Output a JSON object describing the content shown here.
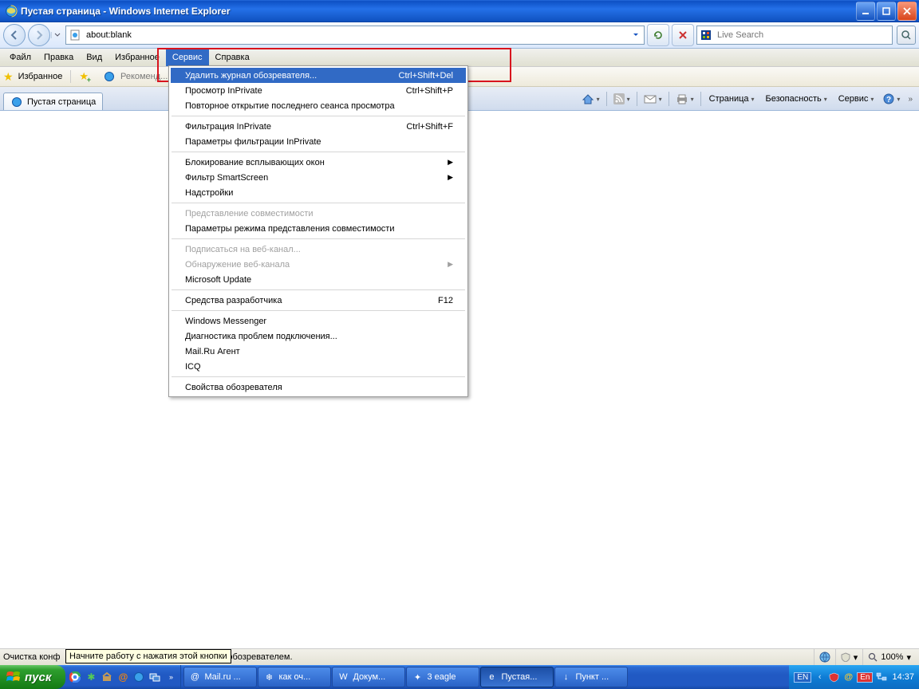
{
  "title": "Пустая страница - Windows Internet Explorer",
  "nav": {
    "address": "about:blank",
    "search_placeholder": "Live Search"
  },
  "menubar": {
    "items": [
      "Файл",
      "Правка",
      "Вид",
      "Избранное",
      "Сервис",
      "Справка"
    ],
    "open_index": 4
  },
  "favbar": {
    "label": "Избранное",
    "suggest": "Рекоменд..."
  },
  "tab": {
    "title": "Пустая страница"
  },
  "cmdbar": {
    "page": "Страница",
    "security": "Безопасность",
    "service": "Сервис"
  },
  "dropdown": {
    "groups": [
      [
        {
          "label": "Удалить журнал обозревателя...",
          "shortcut": "Ctrl+Shift+Del",
          "highlighted": true
        },
        {
          "label": "Просмотр InPrivate",
          "shortcut": "Ctrl+Shift+P"
        },
        {
          "label": "Повторное открытие последнего сеанса просмотра"
        }
      ],
      [
        {
          "label": "Фильтрация InPrivate",
          "shortcut": "Ctrl+Shift+F"
        },
        {
          "label": "Параметры фильтрации InPrivate"
        }
      ],
      [
        {
          "label": "Блокирование всплывающих окон",
          "submenu": true
        },
        {
          "label": "Фильтр SmartScreen",
          "submenu": true
        },
        {
          "label": "Надстройки"
        }
      ],
      [
        {
          "label": "Представление совместимости",
          "disabled": true
        },
        {
          "label": "Параметры режима представления совместимости"
        }
      ],
      [
        {
          "label": "Подписаться на веб-канал...",
          "disabled": true
        },
        {
          "label": "Обнаружение веб-канала",
          "submenu": true,
          "disabled": true
        },
        {
          "label": "Microsoft Update"
        }
      ],
      [
        {
          "label": "Средства разработчика",
          "shortcut": "F12"
        }
      ],
      [
        {
          "label": "Windows Messenger"
        },
        {
          "label": "Диагностика проблем подключения..."
        },
        {
          "label": "Mail.Ru Агент"
        },
        {
          "label": "ICQ"
        }
      ],
      [
        {
          "label": "Свойства обозревателя"
        }
      ]
    ]
  },
  "statusbar": {
    "text_left": "Очистка конф",
    "text_right": "обозревателем.",
    "tooltip": "Начните работу с нажатия этой кнопки",
    "zoom": "100%"
  },
  "taskbar": {
    "start": "пуск",
    "items": [
      {
        "icon": "@",
        "label": "Mail.ru ..."
      },
      {
        "icon": "❄",
        "label": "как оч..."
      },
      {
        "icon": "W",
        "label": "Докум..."
      },
      {
        "icon": "✦",
        "label": "3 eagle"
      },
      {
        "icon": "e",
        "label": "Пустая..."
      },
      {
        "icon": "↓",
        "label": "Пункт ..."
      }
    ],
    "active_index": 4,
    "lang1": "EN",
    "lang2": "En",
    "clock": "14:37"
  }
}
